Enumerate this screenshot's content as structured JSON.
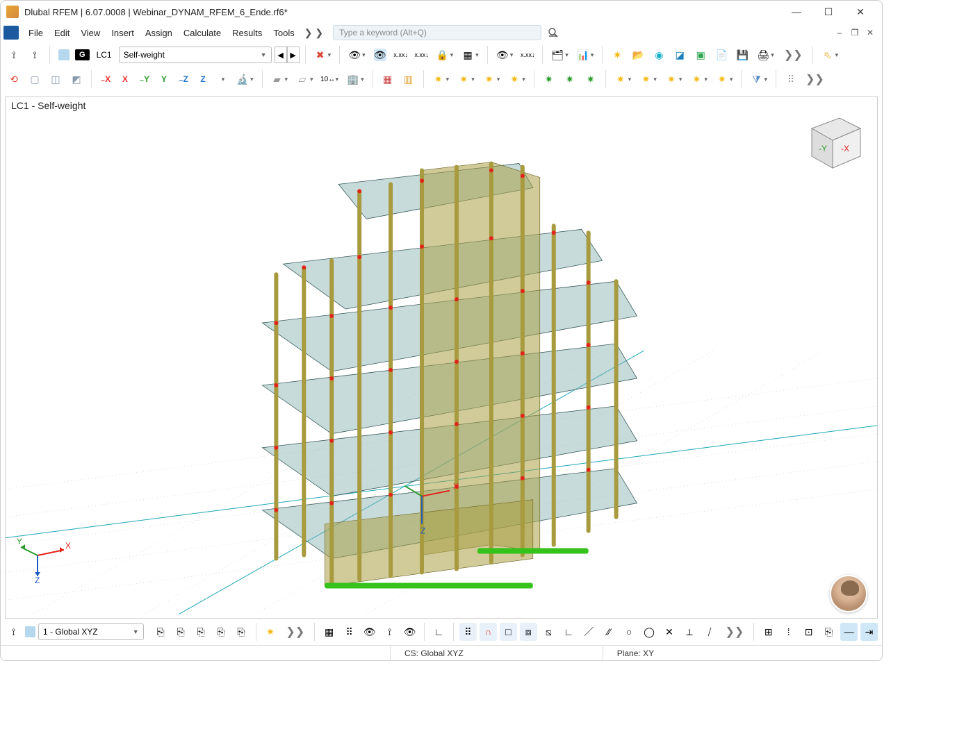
{
  "title": "Dlubal RFEM | 6.07.0008 | Webinar_DYNAM_RFEM_6_Ende.rf6*",
  "menu": {
    "items": [
      "File",
      "Edit",
      "View",
      "Insert",
      "Assign",
      "Calculate",
      "Results",
      "Tools"
    ],
    "more": "❯ ❯"
  },
  "search": {
    "placeholder": "Type a keyword (Alt+Q)"
  },
  "loadcase": {
    "badge": "G",
    "code": "LC1",
    "name": "Self-weight"
  },
  "viewport": {
    "label": "LC1 - Self-weight"
  },
  "bottom": {
    "workplane": "1 - Global XYZ"
  },
  "status": {
    "cs": "CS: Global XYZ",
    "plane": "Plane: XY"
  },
  "navcube": {
    "y": "-Y",
    "x": "-X"
  },
  "axes": {
    "x": "X",
    "y": "Y",
    "z": "Z"
  },
  "origin": {
    "x": "X",
    "z": "Z"
  }
}
